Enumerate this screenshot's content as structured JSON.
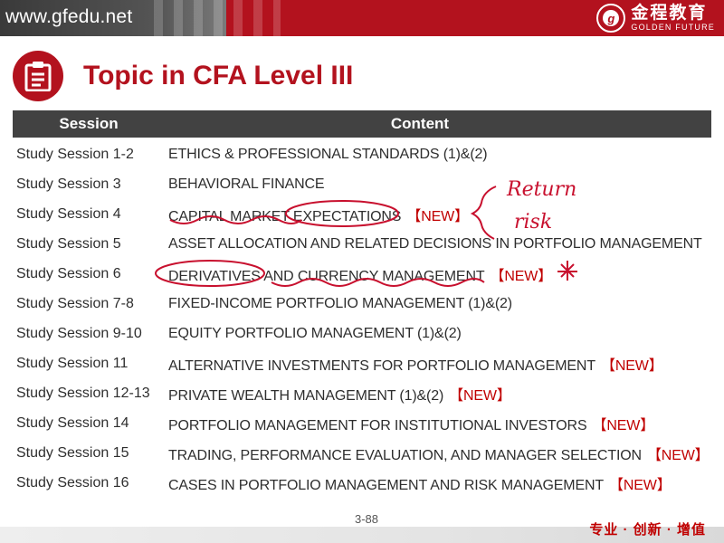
{
  "header": {
    "site_url": "www.gfedu.net",
    "brand_cn": "金程教育",
    "brand_en": "GOLDEN FUTURE",
    "brand_mark": "g"
  },
  "title": "Topic in CFA Level III",
  "table": {
    "headers": {
      "session": "Session",
      "content": "Content"
    },
    "rows": [
      {
        "session": "Study Session 1-2",
        "content": "ETHICS & PROFESSIONAL STANDARDS (1)&(2)",
        "badge": ""
      },
      {
        "session": "Study Session 3",
        "content": "BEHAVIORAL FINANCE",
        "badge": ""
      },
      {
        "session": "Study Session 4",
        "content": "CAPITAL MARKET EXPECTATIONS",
        "badge": "【NEW】"
      },
      {
        "session": "Study Session 5",
        "content": "ASSET ALLOCATION AND RELATED DECISIONS IN PORTFOLIO MANAGEMENT",
        "badge": ""
      },
      {
        "session": "Study Session 6",
        "content": "DERIVATIVES AND CURRENCY MANAGEMENT",
        "badge": "【NEW】"
      },
      {
        "session": "Study Session 7-8",
        "content": "FIXED-INCOME PORTFOLIO MANAGEMENT (1)&(2)",
        "badge": ""
      },
      {
        "session": "Study Session 9-10",
        "content": "EQUITY PORTFOLIO MANAGEMENT (1)&(2)",
        "badge": ""
      },
      {
        "session": "Study Session 11",
        "content": "ALTERNATIVE INVESTMENTS FOR PORTFOLIO MANAGEMENT",
        "badge": "【NEW】"
      },
      {
        "session": "Study Session 12-13",
        "content": "PRIVATE WEALTH MANAGEMENT (1)&(2)",
        "badge": "【NEW】"
      },
      {
        "session": "Study Session 14",
        "content": "PORTFOLIO MANAGEMENT FOR INSTITUTIONAL INVESTORS",
        "badge": "【NEW】"
      },
      {
        "session": "Study Session 15",
        "content": "TRADING, PERFORMANCE EVALUATION, AND MANAGER SELECTION",
        "badge": "【NEW】"
      },
      {
        "session": "Study Session 16",
        "content": "CASES IN PORTFOLIO MANAGEMENT AND RISK MANAGEMENT",
        "badge": "【NEW】"
      }
    ]
  },
  "annotations": {
    "note_return": "Return",
    "note_risk": "risk"
  },
  "footer": {
    "page_number": "3-88",
    "slogan": "专业 · 创新 · 增值"
  },
  "colors": {
    "brand_red": "#b3121e",
    "header_gray": "#424242",
    "badge_red": "#c00000",
    "ink_red": "#c8102e"
  },
  "icons": {
    "title_icon": "clipboard-icon",
    "brand_icon": "seal-logo-icon"
  }
}
